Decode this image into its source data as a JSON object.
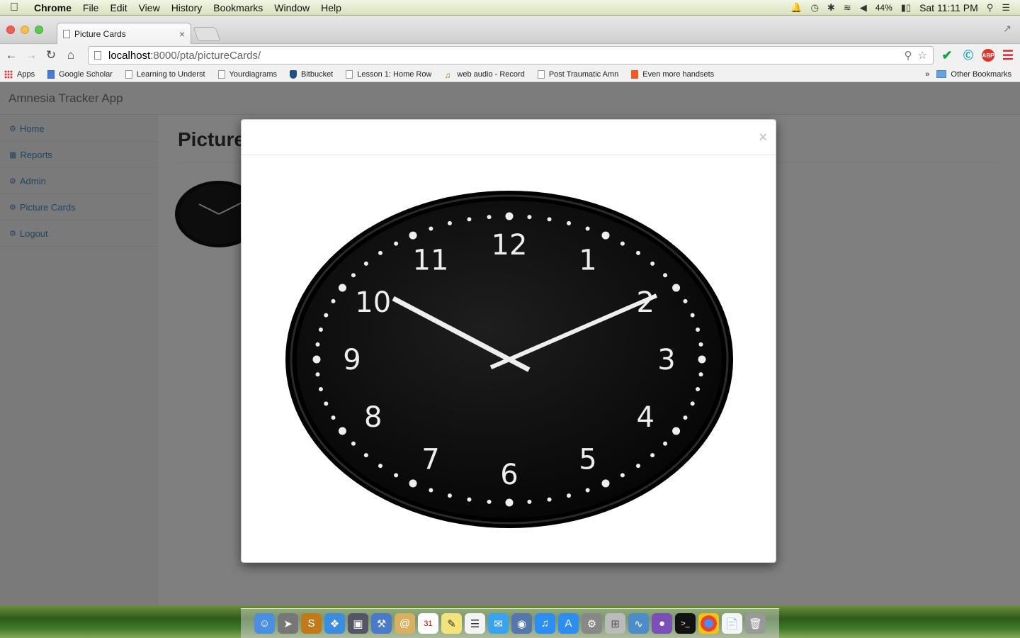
{
  "menubar": {
    "app": "Chrome",
    "items": [
      "File",
      "Edit",
      "View",
      "History",
      "Bookmarks",
      "Window",
      "Help"
    ],
    "battery": "44%",
    "clock": "Sat 11:11 PM"
  },
  "browser": {
    "tab_title": "Picture Cards",
    "tab_close": "×",
    "url_host": "localhost",
    "url_rest": ":8000/pta/pictureCards/",
    "bookmarks": [
      {
        "label": "Apps",
        "icon": "apps"
      },
      {
        "label": "Google Scholar",
        "icon": "scholar"
      },
      {
        "label": "Learning to Underst",
        "icon": "page"
      },
      {
        "label": "Yourdiagrams",
        "icon": "page"
      },
      {
        "label": "Bitbucket",
        "icon": "bucket"
      },
      {
        "label": "Lesson 1: Home Row",
        "icon": "page"
      },
      {
        "label": "web audio - Record",
        "icon": "audio"
      },
      {
        "label": "Post Traumatic Amn",
        "icon": "page"
      },
      {
        "label": "Even more handsets",
        "icon": "orange"
      }
    ],
    "overflow": "»",
    "other_bookmarks": "Other Bookmarks"
  },
  "app": {
    "brand": "Amnesia Tracker App",
    "nav": [
      {
        "label": "Home",
        "icon": "dashboard-icon"
      },
      {
        "label": "Reports",
        "icon": "table-icon"
      },
      {
        "label": "Admin",
        "icon": "dashboard-icon"
      },
      {
        "label": "Picture Cards",
        "icon": "dashboard-icon"
      },
      {
        "label": "Logout",
        "icon": "dashboard-icon"
      }
    ],
    "page_title": "Picture Cards"
  },
  "modal": {
    "close": "×"
  },
  "clock": {
    "numerals": [
      "12",
      "1",
      "2",
      "3",
      "4",
      "5",
      "6",
      "7",
      "8",
      "9",
      "10",
      "11"
    ],
    "time": "10:10"
  },
  "colors": {
    "link": "#428bca",
    "clock_face": "#0b0b0b",
    "hands": "#eeeeee"
  }
}
